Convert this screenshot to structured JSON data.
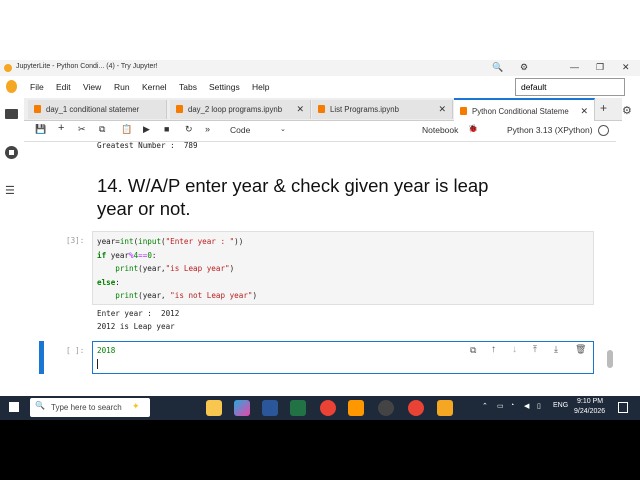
{
  "window": {
    "title": "JupyterLite - Python Condi... (4) - Try Jupyter!",
    "controls": [
      "🔍",
      "⚙",
      "—",
      "❐",
      "✕"
    ]
  },
  "menu": {
    "items": [
      "File",
      "Edit",
      "View",
      "Run",
      "Kernel",
      "Tabs",
      "Settings",
      "Help"
    ],
    "theme_value": "default"
  },
  "tabs": [
    {
      "label": "day_1 conditional statemer"
    },
    {
      "label": "day_2 loop programs.ipynb"
    },
    {
      "label": "List Programs.ipynb"
    },
    {
      "label": "Python Conditional Stateme"
    }
  ],
  "toolbar": {
    "cell_type": "Code",
    "notebook_label": "Notebook",
    "kernel_label": "Python 3.13 (XPython)"
  },
  "notebook": {
    "prev_output": "Greatest Number :  789",
    "heading_line1": "14. W/A/P enter year & check given year is leap",
    "heading_line2": "year or not.",
    "cell3": {
      "prompt": "[3]:",
      "line1_a": "year=",
      "line1_b": "int",
      "line1_c": "(",
      "line1_d": "input",
      "line1_e": "(",
      "line1_f": "\"Enter year : \"",
      "line1_g": "))",
      "line2_kw": "if",
      "line2_a": " year",
      "line2_b": "%",
      "line2_c": "4",
      "line2_d": "==",
      "line2_e": "0",
      "line2_f": ":",
      "line3_a": "    ",
      "line3_b": "print",
      "line3_c": "(year,",
      "line3_d": "\"is Leap year\"",
      "line3_e": ")",
      "line4_kw": "else",
      "line4_a": ":",
      "line5_a": "    ",
      "line5_b": "print",
      "line5_c": "(year, ",
      "line5_d": "\"is not Leap year\"",
      "line5_e": ")"
    },
    "output_line1": "Enter year :  2012",
    "output_line2": "2012 is Leap year",
    "cell4": {
      "prompt": "[ ]:",
      "input_value": "2018"
    }
  },
  "taskbar": {
    "search_placeholder": "Type here to search",
    "time": "9:10 PM",
    "date": "9/24/2026",
    "lang": "ENG"
  }
}
